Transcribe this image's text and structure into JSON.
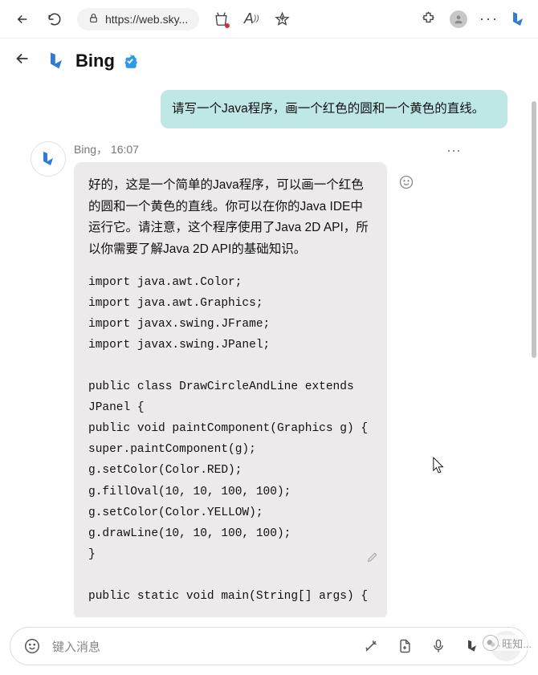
{
  "browser": {
    "url": "https://web.sky..."
  },
  "header": {
    "title": "Bing"
  },
  "chat": {
    "user_message": "请写一个Java程序，画一个红色的圆和一个黄色的直线。",
    "bot_name": "Bing",
    "bot_time": "16:07",
    "bot_meta": "Bing， 16:07",
    "intro": "好的，这是一个简单的Java程序，可以画一个红色的圆和一个黄色的直线。你可以在你的Java IDE中运行它。请注意，这个程序使用了Java 2D API，所以你需要了解Java 2D API的基础知识。",
    "code": "import java.awt.Color;\nimport java.awt.Graphics;\nimport javax.swing.JFrame;\nimport javax.swing.JPanel;\n\npublic class DrawCircleAndLine extends JPanel {\npublic void paintComponent(Graphics g) {\nsuper.paintComponent(g);\ng.setColor(Color.RED);\ng.fillOval(10, 10, 100, 100);\ng.setColor(Color.YELLOW);\ng.drawLine(10, 10, 100, 100);\n}\n\npublic static void main(String[] args) {"
  },
  "input": {
    "placeholder": "键入消息"
  },
  "watermark": {
    "text": "旺知..."
  }
}
